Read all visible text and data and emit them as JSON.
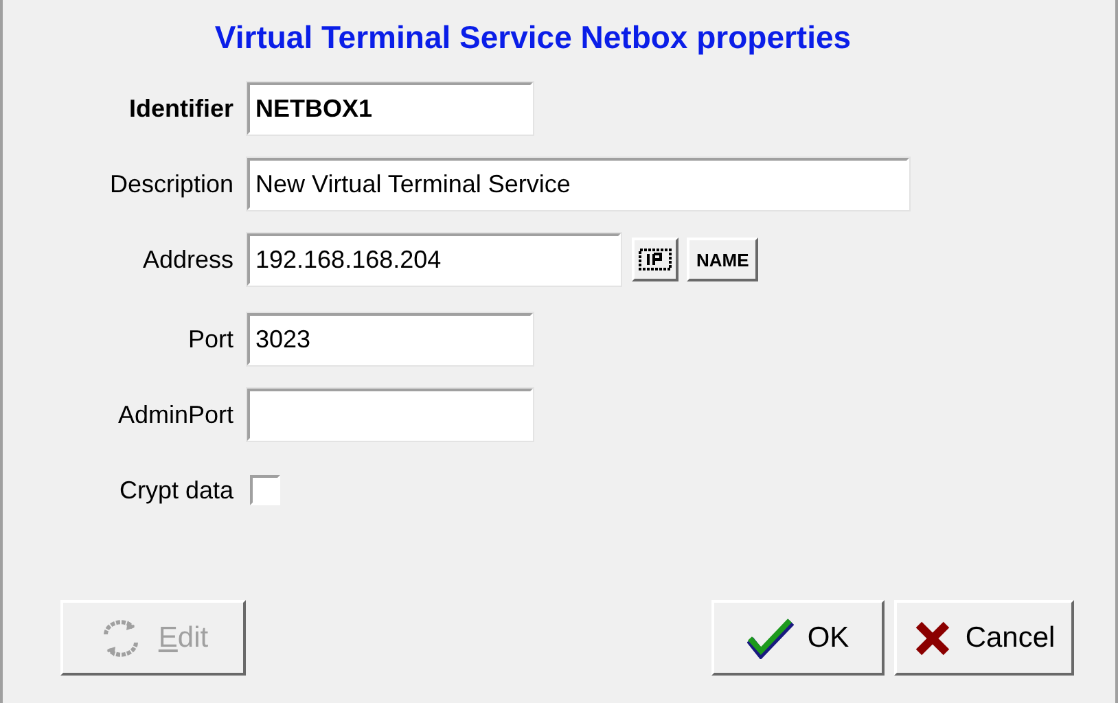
{
  "title": "Virtual Terminal Service Netbox properties",
  "fields": [
    {
      "kind": "text",
      "label": "Identifier",
      "value": "NETBOX1",
      "bold": true
    },
    {
      "kind": "text",
      "label": "Description",
      "value": "New Virtual Terminal Service",
      "bold": false
    },
    {
      "kind": "address",
      "label": "Address",
      "value": "192.168.168.204",
      "bold": false,
      "name_button": "NAME"
    },
    {
      "kind": "text",
      "label": "Port",
      "value": "3023",
      "bold": false
    },
    {
      "kind": "text",
      "label": "AdminPort",
      "bold": false
    },
    {
      "kind": "checkbox",
      "label": "Crypt data",
      "checked": false
    }
  ],
  "buttons": [
    {
      "kind": "edit",
      "label": "Edit",
      "disabled": true
    },
    {
      "kind": "ok",
      "label": "OK",
      "disabled": false
    },
    {
      "kind": "cancel",
      "label": "Cancel",
      "disabled": false
    }
  ]
}
